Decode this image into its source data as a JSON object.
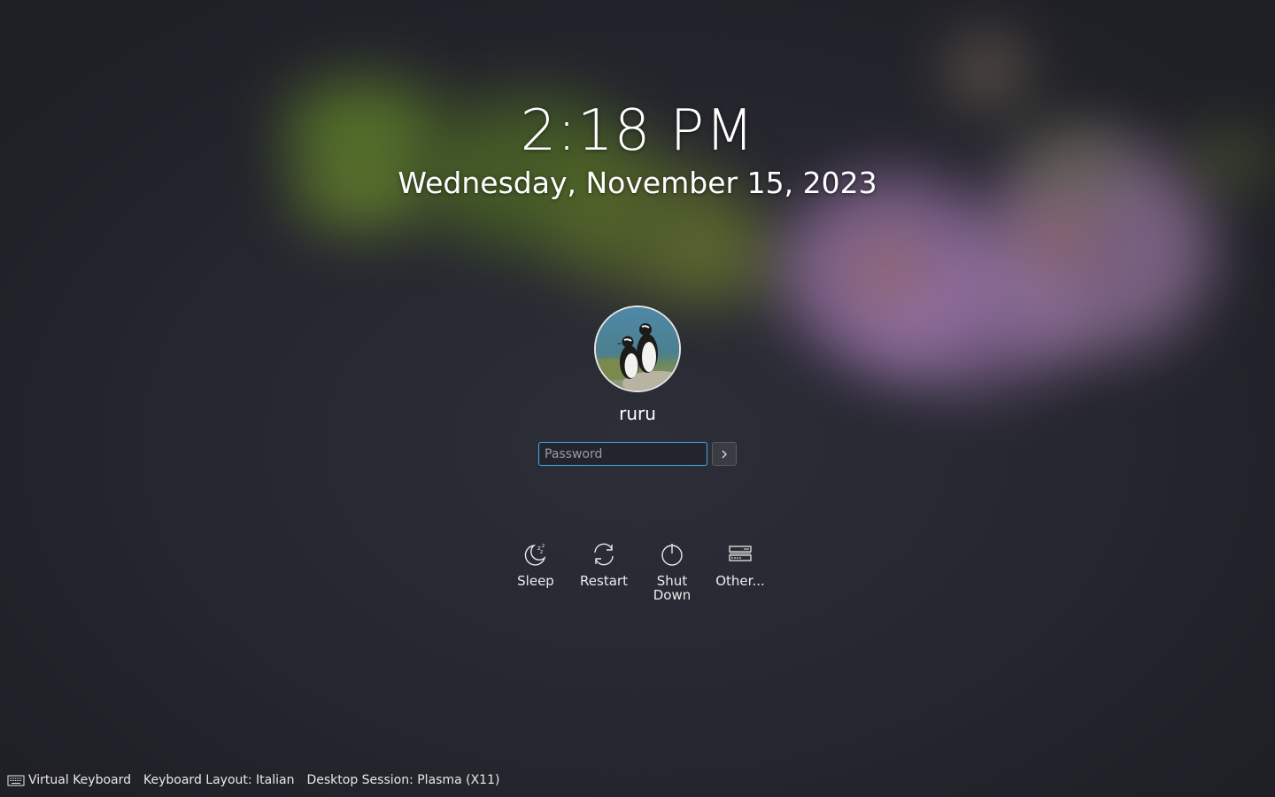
{
  "lock_screen": {
    "time": "2:18 PM",
    "date": "Wednesday, November 15, 2023"
  },
  "user": {
    "name": "ruru",
    "avatar_icon": "penguin-avatar"
  },
  "login": {
    "password_placeholder": "Password",
    "password_value": "",
    "submit_icon": "chevron-right-icon"
  },
  "actions": [
    {
      "label": "Sleep",
      "icon": "sleep-icon"
    },
    {
      "label": "Restart",
      "icon": "restart-icon"
    },
    {
      "label": "Shut Down",
      "icon": "power-icon"
    },
    {
      "label": "Other...",
      "icon": "switch-user-icon"
    }
  ],
  "footer": {
    "virtual_keyboard": "Virtual Keyboard",
    "keyboard_layout": "Keyboard Layout: Italian",
    "desktop_session": "Desktop Session: Plasma (X11)"
  },
  "colors": {
    "accent": "#3daee9",
    "background": "#26272f"
  }
}
